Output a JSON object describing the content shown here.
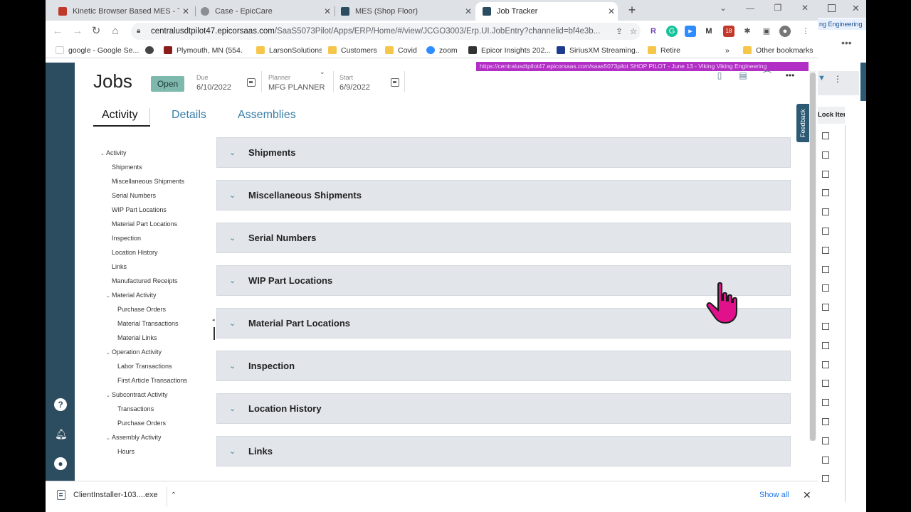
{
  "browser": {
    "tabs": [
      {
        "title": "Kinetic Browser Based MES - Test",
        "favicon_color": "#c0392b"
      },
      {
        "title": "Case - EpicCare",
        "favicon_color": "#8a8f94"
      },
      {
        "title": "MES (Shop Floor)",
        "favicon_color": "#2c4c60"
      },
      {
        "title": "Job Tracker",
        "favicon_color": "#2c4c60"
      }
    ],
    "new_tab_label": "+",
    "url_host": "centralusdtpilot47.epicorsaas.com",
    "url_path": "/SaaS5073Pilot/Apps/ERP/Home/#/view/JCGO3003/Erp.UI.JobEntry?channelid=bf4e3b...",
    "bookmarks": [
      {
        "label": "google - Google Se...",
        "color": "#fff"
      },
      {
        "label": "",
        "color": "#444"
      },
      {
        "label": "Plymouth, MN (554...",
        "color": "#8a1c1c"
      },
      {
        "label": "LarsonSolutions",
        "color": "#f6c64b"
      },
      {
        "label": "Customers",
        "color": "#f6c64b"
      },
      {
        "label": "Covid",
        "color": "#f6c64b"
      },
      {
        "label": "zoom",
        "color": "#2d8cff"
      },
      {
        "label": "Epicor Insights 202...",
        "color": "#333"
      },
      {
        "label": "SiriusXM Streaming...",
        "color": "#1d3b8f"
      },
      {
        "label": "Retire",
        "color": "#f6c64b"
      }
    ],
    "bookmarks_overflow": "»",
    "other_bookmarks": "Other bookmarks"
  },
  "env_banner": "https://centralusdtpilot47.epicorsaas.com/saas5073pilot   SHOP   PILOT - June 13 - Viking   Viking Engineering",
  "header": {
    "title": "Jobs",
    "status": "Open",
    "due_label": "Due",
    "due_value": "6/10/2022",
    "planner_label": "Planner",
    "planner_value": "MFG PLANNER",
    "start_label": "Start",
    "start_value": "6/9/2022"
  },
  "tabs": [
    {
      "label": "Activity"
    },
    {
      "label": "Details"
    },
    {
      "label": "Assemblies"
    }
  ],
  "feedback_label": "Feedback",
  "tree": [
    {
      "label": "Activity",
      "level": 0,
      "caret": true
    },
    {
      "label": "Shipments",
      "level": 1,
      "caret": false
    },
    {
      "label": "Miscellaneous Shipments",
      "level": 1,
      "caret": false
    },
    {
      "label": "Serial Numbers",
      "level": 1,
      "caret": false
    },
    {
      "label": "WIP Part Locations",
      "level": 1,
      "caret": false
    },
    {
      "label": "Material Part Locations",
      "level": 1,
      "caret": false
    },
    {
      "label": "Inspection",
      "level": 1,
      "caret": false
    },
    {
      "label": "Location History",
      "level": 1,
      "caret": false
    },
    {
      "label": "Links",
      "level": 1,
      "caret": false
    },
    {
      "label": "Manufactured Receipts",
      "level": 1,
      "caret": false
    },
    {
      "label": "Material Activity",
      "level": 1,
      "caret": true
    },
    {
      "label": "Purchase Orders",
      "level": 2,
      "caret": false
    },
    {
      "label": "Material Transactions",
      "level": 2,
      "caret": false
    },
    {
      "label": "Material Links",
      "level": 2,
      "caret": false
    },
    {
      "label": "Operation Activity",
      "level": 1,
      "caret": true
    },
    {
      "label": "Labor Transactions",
      "level": 2,
      "caret": false
    },
    {
      "label": "First Article Transactions",
      "level": 2,
      "caret": false
    },
    {
      "label": "Subcontract Activity",
      "level": 1,
      "caret": true
    },
    {
      "label": "Transactions",
      "level": 2,
      "caret": false
    },
    {
      "label": "Purchase Orders",
      "level": 2,
      "caret": false
    },
    {
      "label": "Assembly Activity",
      "level": 1,
      "caret": true
    },
    {
      "label": "Hours",
      "level": 2,
      "caret": false
    }
  ],
  "panels": [
    {
      "title": "Shipments"
    },
    {
      "title": "Miscellaneous Shipments"
    },
    {
      "title": "Serial Numbers"
    },
    {
      "title": "WIP Part Locations"
    },
    {
      "title": "Material Part Locations"
    },
    {
      "title": "Inspection"
    },
    {
      "title": "Location History"
    },
    {
      "title": "Links"
    }
  ],
  "downloads": {
    "file_name": "ClientInstaller-103....exe",
    "show_all": "Show all"
  },
  "right_window": {
    "pill_label": "ng Engineering",
    "column_header": "Lock Iter"
  },
  "colors": {
    "rail": "#2c4c60",
    "accent": "#3a7ea8",
    "status_chip": "#7fb8ad",
    "env_banner": "#b12fc4",
    "panel_bg": "#e2e6ea",
    "cursor": "#e0118a"
  }
}
